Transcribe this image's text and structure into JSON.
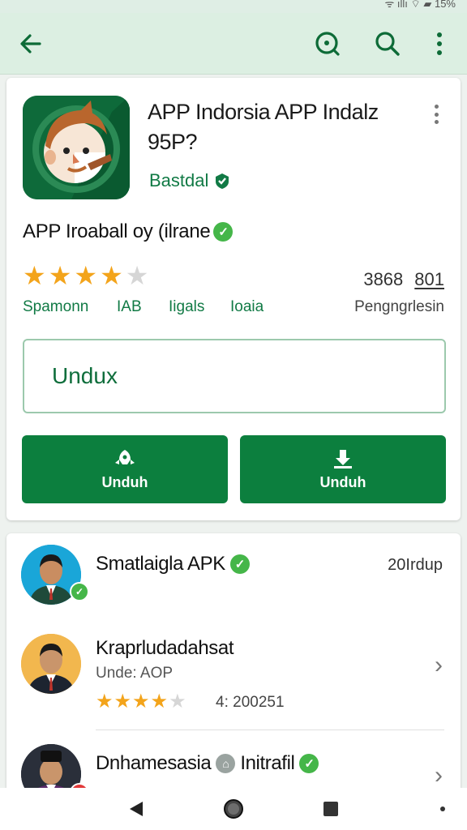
{
  "status_bar": {
    "text": "ᯤ ıllı ⌔ ▰ 15%"
  },
  "app_bar": {
    "back_icon": "arrow-left-icon",
    "icons": [
      "lens-icon",
      "search-icon",
      "more-vert-icon"
    ]
  },
  "app": {
    "title": "APP Indorsia APP Indalz 95P?",
    "publisher": "Bastdal",
    "byline": "APP Iroaball oy (ilrane",
    "rating_stars": 4,
    "rating_max": 5,
    "stat_a": "3868",
    "stat_b": "801",
    "meta": [
      "Spamonn",
      "IAB",
      "Iigals",
      "Ioaia",
      "Pengngrlesin"
    ],
    "input_value": "Undux",
    "buttons": [
      {
        "label": "Unduh",
        "icon": "rocket-icon"
      },
      {
        "label": "Unduh",
        "icon": "download-icon"
      }
    ]
  },
  "developers": [
    {
      "name": "Smatlaigla APK",
      "date": "20Irdup",
      "verified": true
    },
    {
      "name": "Kraprludadahsat",
      "sub": "Unde: AOP",
      "rating_stars": 4,
      "rating_count": "4: 200251"
    },
    {
      "name": "Dnhamesasia",
      "name_suffix": "Initrafil",
      "verified": true
    }
  ],
  "colors": {
    "accent": "#0c7f3e",
    "star": "#f3a41b",
    "app_bar": "#dcefe2"
  },
  "nav": [
    "back-triangle-icon",
    "home-circle-icon",
    "recents-square-icon"
  ]
}
